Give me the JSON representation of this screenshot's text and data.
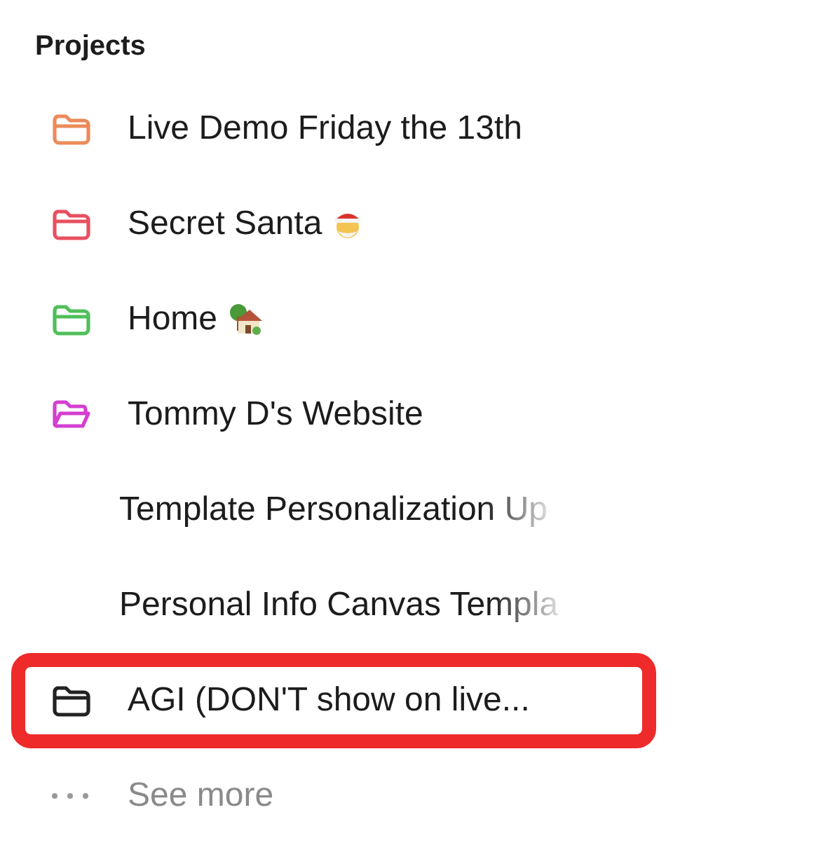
{
  "section": {
    "title": "Projects"
  },
  "items": [
    {
      "kind": "folder",
      "label": "Live Demo Friday the 13th",
      "color": "#ec8a5a",
      "open": false,
      "highlighted": false
    },
    {
      "kind": "folder",
      "label": "Secret Santa",
      "color": "#e8505f",
      "open": false,
      "highlighted": false
    },
    {
      "kind": "folder",
      "label": "Home",
      "color": "#4fbf5a",
      "open": false,
      "highlighted": false
    },
    {
      "kind": "folder",
      "label": "Tommy D's Website",
      "color": "#d43fd0",
      "open": true,
      "highlighted": false
    },
    {
      "kind": "page",
      "label": "Template Personalization Up",
      "highlighted": false
    },
    {
      "kind": "page",
      "label": "Personal Info Canvas Templa",
      "highlighted": false
    },
    {
      "kind": "folder",
      "label": "AGI (DON'T show on live...",
      "color": "#222222",
      "open": false,
      "highlighted": true
    },
    {
      "kind": "more",
      "label": "See more",
      "highlighted": false
    }
  ]
}
